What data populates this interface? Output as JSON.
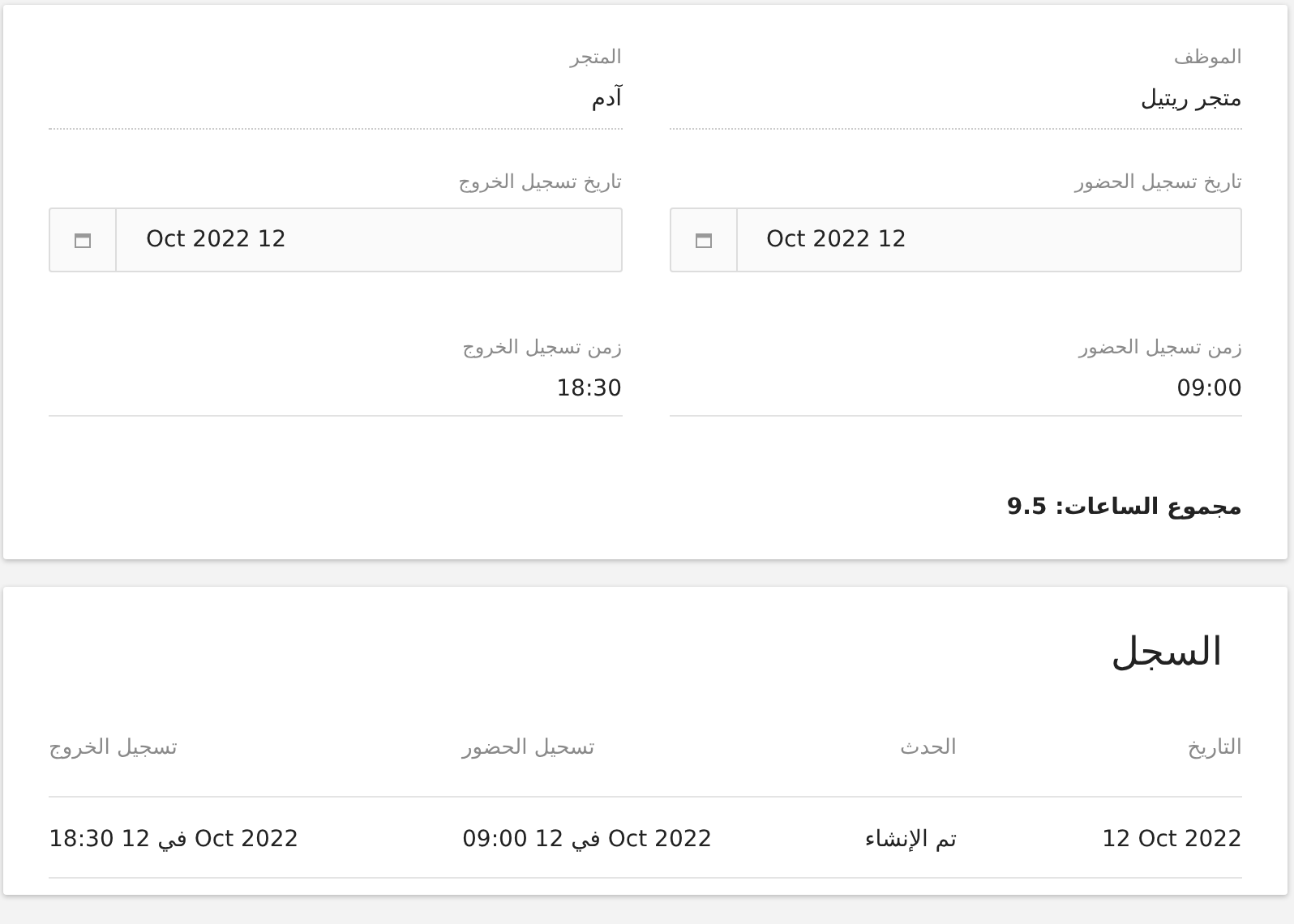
{
  "attendance": {
    "fields": [
      {
        "kind": "text",
        "label": "الموظف",
        "value": "متجر ريتيل"
      },
      {
        "kind": "text",
        "label": "المتجر",
        "value": "آدم"
      },
      {
        "kind": "date",
        "label": "تاريخ تسجيل الحضور",
        "value": "Oct 2022 12"
      },
      {
        "kind": "date",
        "label": "تاريخ تسجيل الخروج",
        "value": "Oct 2022 12"
      },
      {
        "kind": "time",
        "label": "زمن تسجيل الحضور",
        "value": "09:00"
      },
      {
        "kind": "time",
        "label": "زمن تسجيل الخروج",
        "value": "18:30"
      }
    ],
    "total": "مجموع الساعات: 9.5"
  },
  "log": {
    "title": "السجل",
    "columns": [
      "التاريخ",
      "الحدث",
      "تسحيل الحضور",
      "تسجيل الخروج"
    ],
    "rows": [
      [
        "12 Oct 2022",
        "تم الإنشاء",
        "09:00 في 12 Oct 2022",
        "18:30 في 12 Oct 2022"
      ]
    ]
  }
}
